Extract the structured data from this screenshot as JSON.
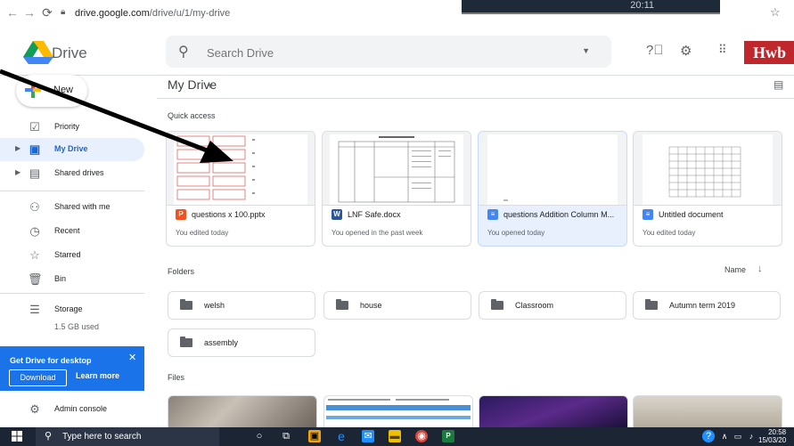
{
  "browser": {
    "url_host": "drive.google.com",
    "url_path": "/drive/u/1/my-drive",
    "clock_partial": "20:11"
  },
  "header": {
    "brand": "Drive",
    "search_placeholder": "Search Drive",
    "badge": "Hwb"
  },
  "sidebar": {
    "new_label": "New",
    "items": [
      {
        "label": "Priority",
        "icon": "check-circle-icon"
      },
      {
        "label": "My Drive",
        "icon": "my-drive-icon",
        "active": true
      },
      {
        "label": "Shared drives",
        "icon": "shared-drives-icon"
      },
      {
        "label": "Shared with me",
        "icon": "people-icon"
      },
      {
        "label": "Recent",
        "icon": "clock-icon"
      },
      {
        "label": "Starred",
        "icon": "star-icon"
      },
      {
        "label": "Bin",
        "icon": "bin-icon"
      },
      {
        "label": "Storage",
        "icon": "storage-icon"
      }
    ],
    "storage_used": "1.5 GB used",
    "promo": {
      "title": "Get Drive for desktop",
      "download": "Download",
      "learn_more": "Learn more"
    },
    "admin": "Admin console"
  },
  "main": {
    "title": "My Drive",
    "quick_access_label": "Quick access",
    "quick_access": [
      {
        "type": "P",
        "type_color": "#f4511e",
        "name": "questions x 100.pptx",
        "sub": "You edited today"
      },
      {
        "type": "W",
        "type_color": "#2b579a",
        "name": "LNF Safe.docx",
        "sub": "You opened in the past week"
      },
      {
        "type": "≡",
        "type_color": "#4285f4",
        "name": "questions Addition Column M...",
        "sub": "You opened today",
        "selected": true
      },
      {
        "type": "≡",
        "type_color": "#4285f4",
        "name": "Untitled document",
        "sub": "You edited today"
      }
    ],
    "folders_label": "Folders",
    "sort_label": "Name",
    "folders": [
      "welsh",
      "house",
      "Classroom",
      "Autumn term 2019",
      "assembly"
    ],
    "files_label": "Files"
  },
  "taskbar": {
    "search_text": "Type here to search",
    "time": "20:58",
    "date": "15/03/20"
  }
}
